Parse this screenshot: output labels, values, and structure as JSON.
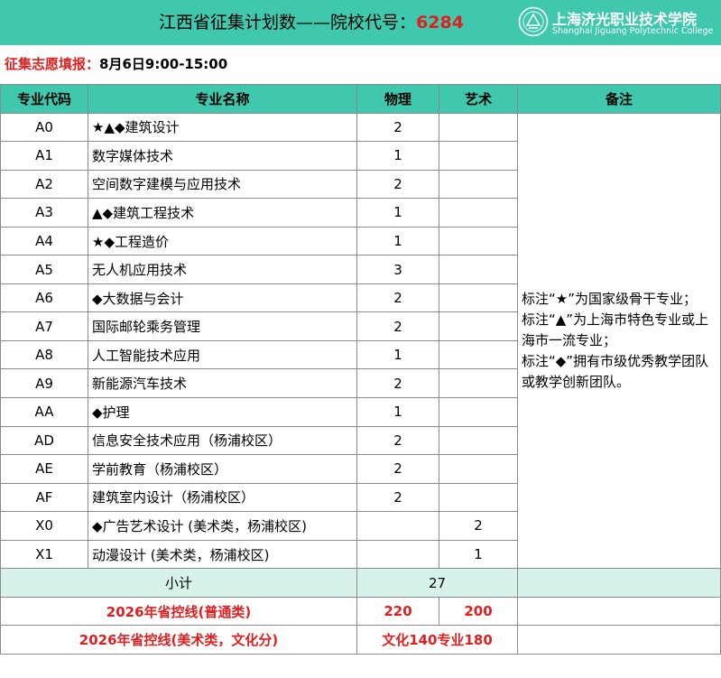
{
  "header": {
    "title_prefix": "江西省征集计划数——院校代号：",
    "school_code": "6284",
    "logo_cn": "上海济光职业技术学院",
    "logo_en": "Shanghai Jiguang Polytechnic College"
  },
  "schedule": {
    "label": "征集志愿填报：",
    "value": "8月6日9:00-15:00"
  },
  "table": {
    "headers": [
      "专业代码",
      "专业名称",
      "物理",
      "艺术",
      "备注"
    ],
    "rows": [
      {
        "code": "A0",
        "name": "★▲◆建筑设计",
        "physics": "2",
        "art": ""
      },
      {
        "code": "A1",
        "name": "数字媒体技术",
        "physics": "1",
        "art": ""
      },
      {
        "code": "A2",
        "name": "空间数字建模与应用技术",
        "physics": "2",
        "art": ""
      },
      {
        "code": "A3",
        "name": "▲◆建筑工程技术",
        "physics": "1",
        "art": ""
      },
      {
        "code": "A4",
        "name": "★◆工程造价",
        "physics": "1",
        "art": ""
      },
      {
        "code": "A5",
        "name": "无人机应用技术",
        "physics": "3",
        "art": ""
      },
      {
        "code": "A6",
        "name": "◆大数据与会计",
        "physics": "2",
        "art": ""
      },
      {
        "code": "A7",
        "name": "国际邮轮乘务管理",
        "physics": "2",
        "art": ""
      },
      {
        "code": "A8",
        "name": "人工智能技术应用",
        "physics": "1",
        "art": ""
      },
      {
        "code": "A9",
        "name": "新能源汽车技术",
        "physics": "2",
        "art": ""
      },
      {
        "code": "AA",
        "name": "◆护理",
        "physics": "1",
        "art": ""
      },
      {
        "code": "AD",
        "name": "信息安全技术应用（杨浦校区）",
        "physics": "2",
        "art": ""
      },
      {
        "code": "AE",
        "name": "学前教育（杨浦校区）",
        "physics": "2",
        "art": ""
      },
      {
        "code": "AF",
        "name": "建筑室内设计（杨浦校区）",
        "physics": "2",
        "art": ""
      },
      {
        "code": "X0",
        "name": "◆广告艺术设计 (美术类，杨浦校区)",
        "physics": "",
        "art": "2"
      },
      {
        "code": "X1",
        "name": "动漫设计 (美术类，杨浦校区)",
        "physics": "",
        "art": "1"
      }
    ],
    "note_lines": [
      "标注“★”为国家级骨干专业；",
      "标注“▲”为上海市特色专业或上海市一流专业；",
      "标注“◆”拥有市级优秀教学团队或教学创新团队。"
    ],
    "subtotal": {
      "label": "小计",
      "value": "27"
    },
    "control_general": {
      "label": "2026年省控线(普通类)",
      "physics": "220",
      "art": "200"
    },
    "control_art": {
      "label": "2026年省控线(美术类，文化分)",
      "value": "文化140专业180"
    }
  },
  "colors": {
    "header_bg": "#3fc8ad",
    "subtotal_bg": "#d7f2eb",
    "accent_red": "#e02020"
  }
}
